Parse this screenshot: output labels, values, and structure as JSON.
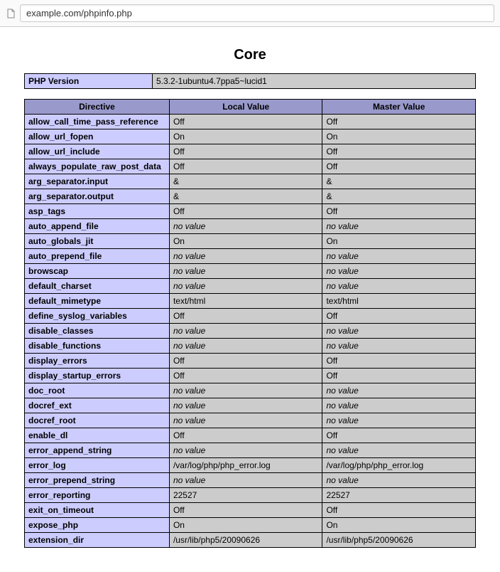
{
  "addressbar": {
    "url": "example.com/phpinfo.php"
  },
  "section_title": "Core",
  "version_row": {
    "label": "PHP Version",
    "value": "5.3.2-1ubuntu4.7ppa5~lucid1"
  },
  "headers": {
    "directive": "Directive",
    "local": "Local Value",
    "master": "Master Value"
  },
  "no_value_text": "no value",
  "directives": [
    {
      "name": "allow_call_time_pass_reference",
      "local": "Off",
      "master": "Off"
    },
    {
      "name": "allow_url_fopen",
      "local": "On",
      "master": "On"
    },
    {
      "name": "allow_url_include",
      "local": "Off",
      "master": "Off"
    },
    {
      "name": "always_populate_raw_post_data",
      "local": "Off",
      "master": "Off"
    },
    {
      "name": "arg_separator.input",
      "local": "&",
      "master": "&"
    },
    {
      "name": "arg_separator.output",
      "local": "&",
      "master": "&"
    },
    {
      "name": "asp_tags",
      "local": "Off",
      "master": "Off"
    },
    {
      "name": "auto_append_file",
      "local": null,
      "master": null
    },
    {
      "name": "auto_globals_jit",
      "local": "On",
      "master": "On"
    },
    {
      "name": "auto_prepend_file",
      "local": null,
      "master": null
    },
    {
      "name": "browscap",
      "local": null,
      "master": null
    },
    {
      "name": "default_charset",
      "local": null,
      "master": null
    },
    {
      "name": "default_mimetype",
      "local": "text/html",
      "master": "text/html"
    },
    {
      "name": "define_syslog_variables",
      "local": "Off",
      "master": "Off"
    },
    {
      "name": "disable_classes",
      "local": null,
      "master": null
    },
    {
      "name": "disable_functions",
      "local": null,
      "master": null
    },
    {
      "name": "display_errors",
      "local": "Off",
      "master": "Off"
    },
    {
      "name": "display_startup_errors",
      "local": "Off",
      "master": "Off"
    },
    {
      "name": "doc_root",
      "local": null,
      "master": null
    },
    {
      "name": "docref_ext",
      "local": null,
      "master": null
    },
    {
      "name": "docref_root",
      "local": null,
      "master": null
    },
    {
      "name": "enable_dl",
      "local": "Off",
      "master": "Off"
    },
    {
      "name": "error_append_string",
      "local": null,
      "master": null
    },
    {
      "name": "error_log",
      "local": "/var/log/php/php_error.log",
      "master": "/var/log/php/php_error.log"
    },
    {
      "name": "error_prepend_string",
      "local": null,
      "master": null
    },
    {
      "name": "error_reporting",
      "local": "22527",
      "master": "22527"
    },
    {
      "name": "exit_on_timeout",
      "local": "Off",
      "master": "Off"
    },
    {
      "name": "expose_php",
      "local": "On",
      "master": "On"
    },
    {
      "name": "extension_dir",
      "local": "/usr/lib/php5/20090626",
      "master": "/usr/lib/php5/20090626"
    }
  ]
}
